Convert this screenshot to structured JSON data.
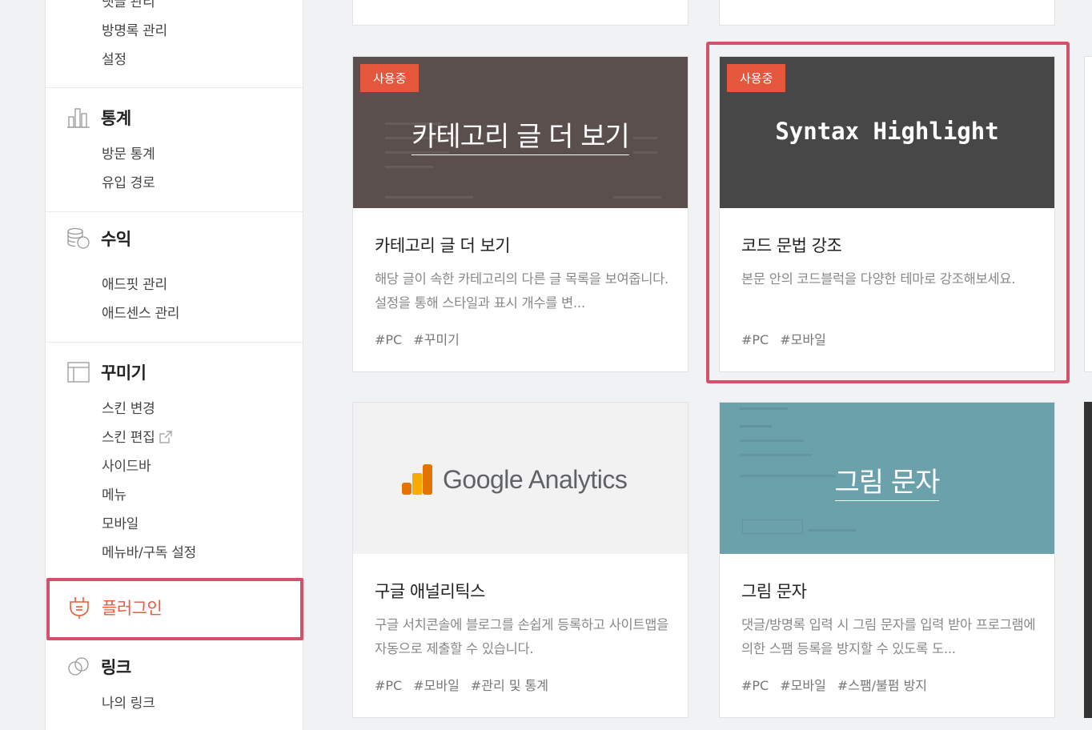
{
  "sidebar": {
    "top_items": [
      "댓글 관리",
      "방명록 관리",
      "설정"
    ],
    "stats": {
      "title": "통계",
      "items": [
        "방문 통계",
        "유입 경로"
      ]
    },
    "revenue": {
      "title": "수익",
      "items": [
        "애드핏 관리",
        "애드센스 관리"
      ]
    },
    "decorate": {
      "title": "꾸미기",
      "items": [
        "스킨 변경",
        "스킨 편집",
        "사이드바",
        "메뉴",
        "모바일",
        "메뉴바/구독 설정"
      ]
    },
    "plugin": {
      "title": "플러그인"
    },
    "link": {
      "title": "링크",
      "items": [
        "나의 링크"
      ]
    }
  },
  "cards": [
    {
      "badge": "사용중",
      "thumb_text": "카테고리 글 더 보기",
      "title": "카테고리 글 더 보기",
      "desc": "해당 글이 속한 카테고리의 다른 글 목록을 보여줍니다. 설정을 통해 스타일과 표시 개수를 변...",
      "tags": [
        "#PC",
        "#꾸미기"
      ]
    },
    {
      "badge": "사용중",
      "thumb_text": "Syntax Highlight",
      "title": "코드 문법 강조",
      "desc": "본문 안의 코드블럭을 다양한 테마로 강조해보세요.",
      "tags": [
        "#PC",
        "#모바일"
      ]
    },
    {
      "thumb_text": "Google Analytics",
      "title": "구글 애널리틱스",
      "desc": "구글 서치콘솔에 블로그를 손쉽게 등록하고 사이트맵을 자동으로 제출할 수 있습니다.",
      "tags": [
        "#PC",
        "#모바일",
        "#관리 및 통계"
      ]
    },
    {
      "thumb_text": "그림 문자",
      "title": "그림 문자",
      "desc": "댓글/방명록 입력 시 그림 문자를 입력 받아 프로그램에 의한 스팸 등록을 방지할 수 있도록 도...",
      "tags": [
        "#PC",
        "#모바일",
        "#스팸/불펌 방지"
      ]
    }
  ],
  "colors": {
    "accent": "#e4573c",
    "highlight_border": "#d3516a"
  },
  "icons": [
    "bar-chart-icon",
    "coins-icon",
    "layout-icon",
    "plug-icon",
    "link-icon",
    "external-link-icon"
  ]
}
